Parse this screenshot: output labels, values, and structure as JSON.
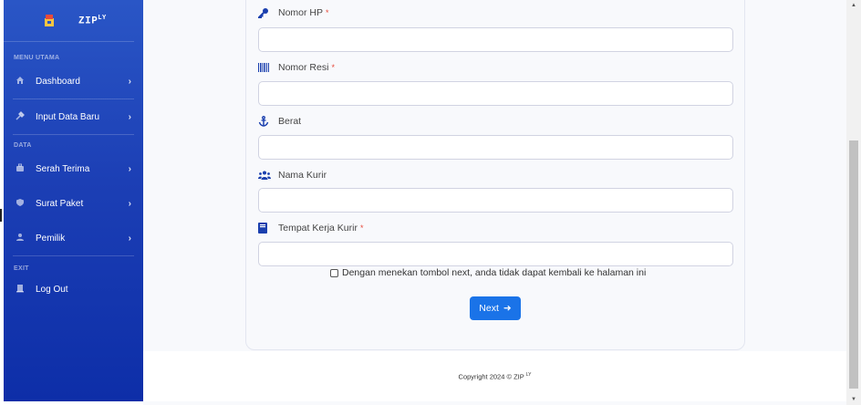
{
  "brand": {
    "name": "ZIP",
    "sup": "LY",
    "logo_icon": "box-logo-icon"
  },
  "sidebar": {
    "sections": [
      {
        "heading": "MENU UTAMA"
      },
      {
        "heading": "DATA"
      },
      {
        "heading": "EXIT"
      }
    ],
    "items": [
      {
        "label": "Dashboard",
        "icon": "home-icon",
        "chevron": "›"
      },
      {
        "label": "Input Data Baru",
        "icon": "tools-icon",
        "chevron": "›"
      },
      {
        "label": "Serah Terima",
        "icon": "briefcase-icon",
        "chevron": "›"
      },
      {
        "label": "Surat Paket",
        "icon": "shield-icon",
        "chevron": "›"
      },
      {
        "label": "Pemilik",
        "icon": "user-icon",
        "chevron": "›"
      },
      {
        "label": "Log Out",
        "icon": "door-icon"
      }
    ]
  },
  "form": {
    "fields": [
      {
        "label": "Nomor HP",
        "required": "*",
        "icon": "key-icon",
        "value": ""
      },
      {
        "label": "Nomor Resi",
        "required": "*",
        "icon": "barcode-icon",
        "value": ""
      },
      {
        "label": "Berat",
        "required": "",
        "icon": "anchor-icon",
        "value": ""
      },
      {
        "label": "Nama Kurir",
        "required": "",
        "icon": "users-icon",
        "value": ""
      },
      {
        "label": "Tempat Kerja Kurir",
        "required": "*",
        "icon": "book-icon",
        "value": ""
      }
    ],
    "agreement": "Dengan menekan tombol next, anda tidak dapat kembali ke halaman ini",
    "next_label": "Next",
    "next_arrow": "➜"
  },
  "footer": {
    "text": "Copyright 2024 © ZIP",
    "sup": "LY"
  },
  "colors": {
    "sidebar": "#1c3fb5",
    "accent": "#1a73e8",
    "icon": "#1a3fae",
    "required": "#e74a3b"
  }
}
